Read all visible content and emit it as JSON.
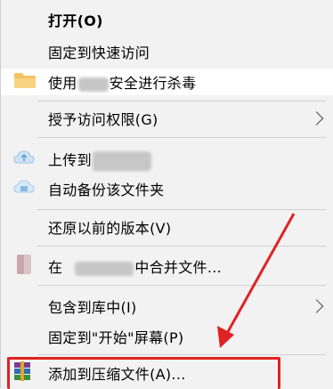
{
  "menu": {
    "open": "打开(O)",
    "pin_quick_access": "固定到快速访问",
    "scan_prefix": "使用",
    "scan_suffix": "安全进行杀毒",
    "grant_access": "授予访问权限(G)",
    "upload_prefix": "上传到",
    "auto_backup": "自动备份该文件夹",
    "restore_versions": "还原以前的版本(V)",
    "merge_prefix": "在",
    "merge_suffix": "中合并文件...",
    "include_library": "包含到库中(I)",
    "pin_start": "固定到\"开始\"屏幕(P)",
    "add_archive": "添加到压缩文件(A)..."
  },
  "icons": {
    "scan": "folder-icon",
    "upload": "cloud-upload-icon",
    "backup": "cloud-backup-icon",
    "merge": "document-icon",
    "archive": "winrar-icon"
  },
  "colors": {
    "annotation": "#e02222",
    "menu_bg": "#f2f2f2"
  }
}
